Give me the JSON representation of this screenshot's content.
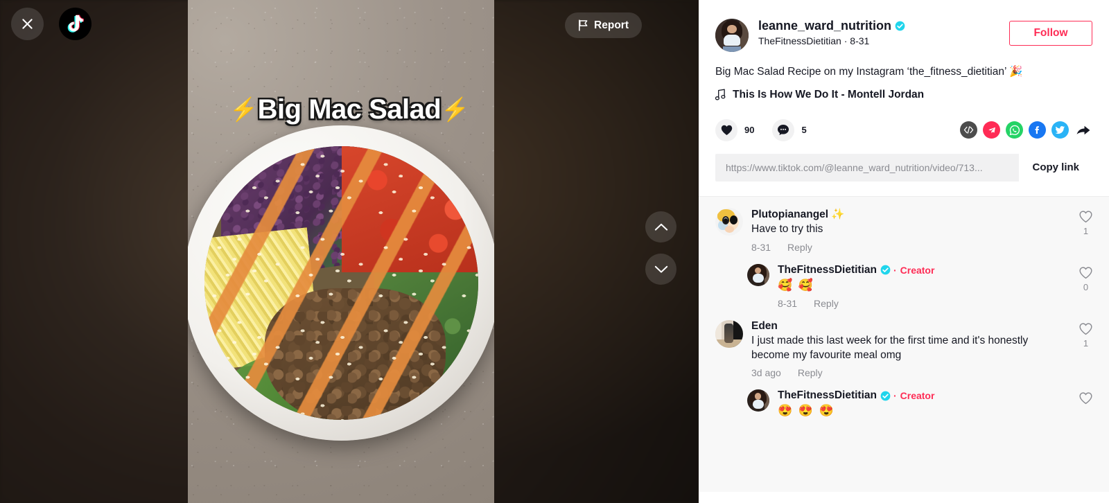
{
  "video": {
    "overlay_title": "Big Mac Salad",
    "overlay_bolt_left": "⚡",
    "overlay_bolt_right": "⚡",
    "close_label": "Close",
    "logo_name": "tiktok-logo",
    "report_label": "Report",
    "prev_label": "Previous video",
    "next_label": "Next video"
  },
  "author": {
    "username": "leanne_ward_nutrition",
    "nickname": "TheFitnessDietitian",
    "separator": "·",
    "date": "8-31",
    "follow_label": "Follow",
    "verified": true
  },
  "post": {
    "caption": "Big Mac Salad Recipe on my Instagram ‘the_fitness_dietitian’ 🎉",
    "music_title": "This Is How We Do It - Montell Jordan",
    "music_icon": "music-note-icon"
  },
  "actions": {
    "like_count": "90",
    "comment_count": "5",
    "share_icons": [
      {
        "name": "embed-icon",
        "label": "</>",
        "color": "#4c4c4c"
      },
      {
        "name": "pinterest-icon",
        "label": "",
        "color": "#ff2b55"
      },
      {
        "name": "whatsapp-icon",
        "label": "",
        "color": "#25d366"
      },
      {
        "name": "facebook-icon",
        "label": "",
        "color": "#1877f2"
      },
      {
        "name": "twitter-icon",
        "label": "",
        "color": "#2ab3f6"
      },
      {
        "name": "share-arrow-icon",
        "label": "",
        "color": "#161823"
      }
    ]
  },
  "copy_link": {
    "url": "https://www.tiktok.com/@leanne_ward_nutrition/video/713...",
    "button_label": "Copy link"
  },
  "comments": [
    {
      "name": "Plutopianangel ✨",
      "text": "Have to try this",
      "time": "8-31",
      "reply_label": "Reply",
      "likes": "1",
      "is_reply": false,
      "creator": false,
      "verified": false,
      "avatar": "cartoon"
    },
    {
      "name": "TheFitnessDietitian",
      "creator_label": "Creator",
      "text": "🥰 🥰",
      "time": "8-31",
      "reply_label": "Reply",
      "likes": "0",
      "is_reply": true,
      "creator": true,
      "verified": true,
      "avatar": "dietitian"
    },
    {
      "name": "Eden",
      "text": "I just made this last week for the first time and it's honestly become my favourite meal omg",
      "time": "3d ago",
      "reply_label": "Reply",
      "likes": "1",
      "is_reply": false,
      "creator": false,
      "verified": false,
      "avatar": "eden"
    },
    {
      "name": "TheFitnessDietitian",
      "creator_label": "Creator",
      "text": "😍 😍 😍",
      "time": "",
      "reply_label": "",
      "likes": "",
      "is_reply": true,
      "creator": true,
      "verified": true,
      "avatar": "dietitian"
    }
  ],
  "colors": {
    "accent_pink": "#FE2C55",
    "verified_blue": "#20D5EC",
    "text_primary": "#161823",
    "text_muted": "#8A8B91",
    "comment_bg": "#F8F8F8"
  }
}
